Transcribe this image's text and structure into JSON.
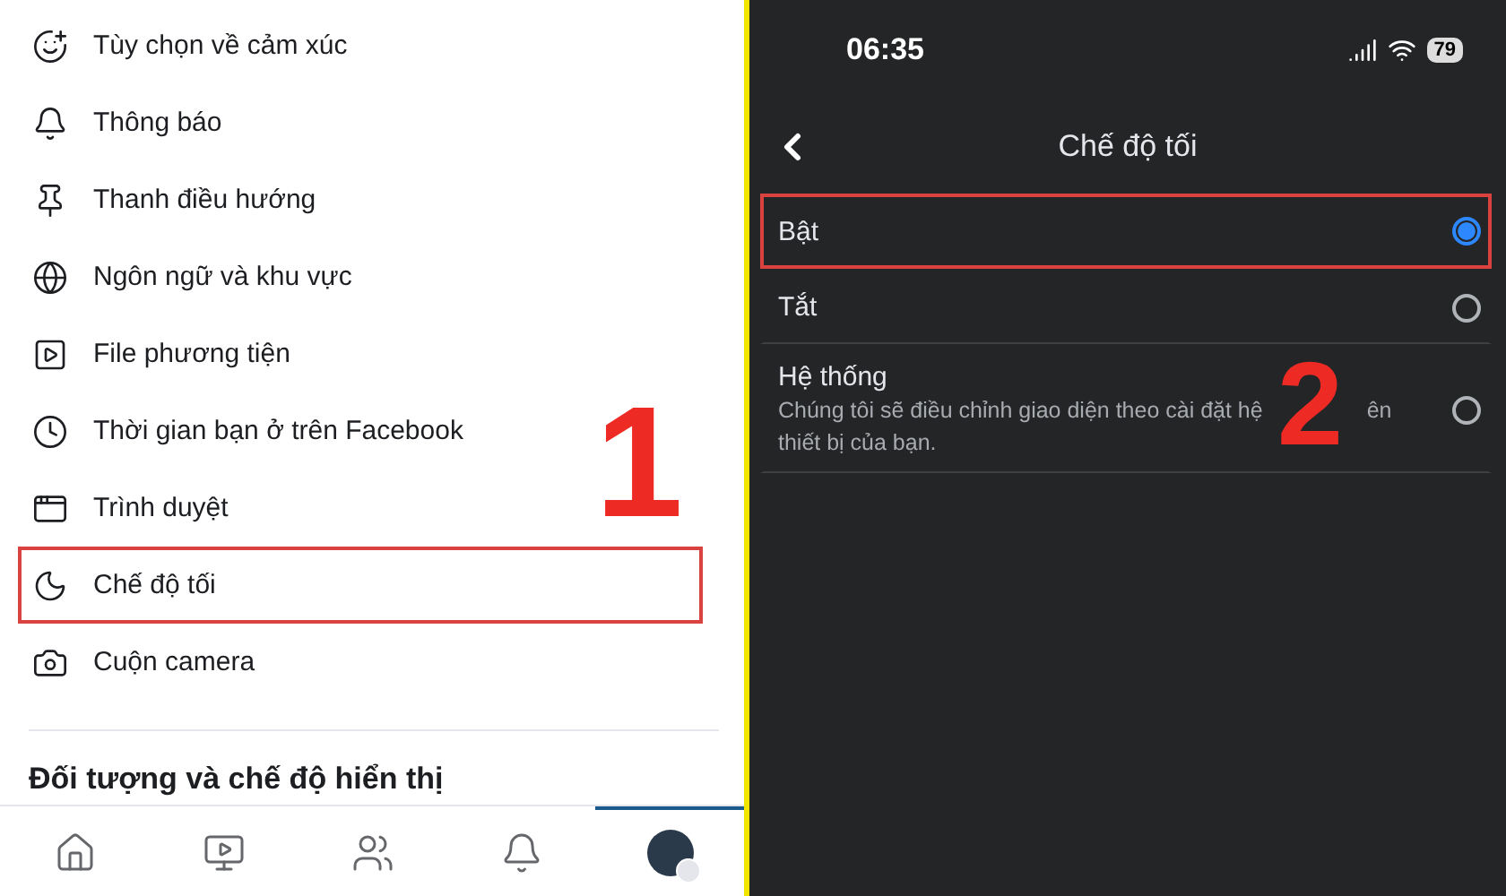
{
  "settings_menu": {
    "items": [
      {
        "label": "Tùy chọn về cảm xúc",
        "highlighted": false
      },
      {
        "label": "Thông báo",
        "highlighted": false
      },
      {
        "label": "Thanh điều hướng",
        "highlighted": false
      },
      {
        "label": "Ngôn ngữ và khu vực",
        "highlighted": false
      },
      {
        "label": "File phương tiện",
        "highlighted": false
      },
      {
        "label": "Thời gian bạn ở trên Facebook",
        "highlighted": false
      },
      {
        "label": "Trình duyệt",
        "highlighted": false
      },
      {
        "label": "Chế độ tối",
        "highlighted": true
      },
      {
        "label": "Cuộn camera",
        "highlighted": false
      }
    ],
    "section_header": "Đối tượng và chế độ hiển thị",
    "step_number": "1"
  },
  "bottom_nav": [
    {
      "selected": false
    },
    {
      "selected": false
    },
    {
      "selected": false
    },
    {
      "selected": false
    },
    {
      "selected": true
    }
  ],
  "dark_mode_screen": {
    "status_bar": {
      "time": "06:35",
      "battery": "79"
    },
    "title": "Chế độ tối",
    "options": [
      {
        "label": "Bật",
        "selected": true,
        "highlighted": true
      },
      {
        "label": "Tắt",
        "selected": false,
        "highlighted": false
      },
      {
        "label": "Hệ thống",
        "selected": false,
        "highlighted": false,
        "description": [
          "Chúng tôi sẽ điều chỉnh giao diện theo cài đặt hệ",
          "ên",
          "thiết bị của bạn."
        ]
      }
    ],
    "step_number": "2"
  }
}
